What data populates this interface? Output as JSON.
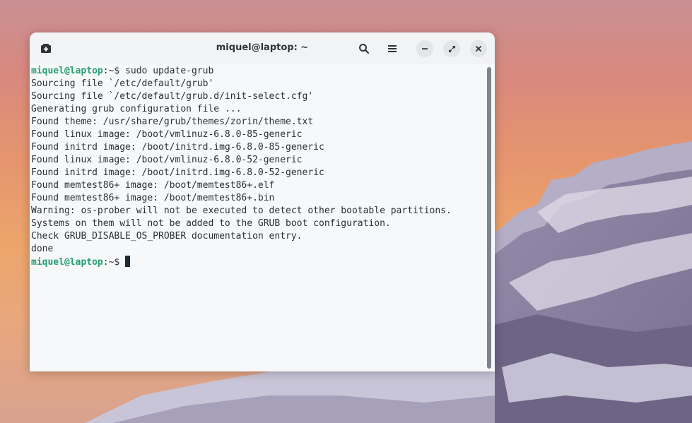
{
  "window": {
    "title": "miquel@laptop: ~"
  },
  "titlebar": {
    "new_tab_icon": "new-tab-icon",
    "search_icon": "search-icon",
    "menu_icon": "hamburger-menu-icon",
    "minimize_icon": "minimize-icon",
    "maximize_icon": "maximize-icon",
    "close_icon": "close-icon"
  },
  "terminal": {
    "prompt_user": "miquel@laptop",
    "prompt_path": ":~$ ",
    "command": "sudo update-grub",
    "output": [
      "Sourcing file `/etc/default/grub'",
      "Sourcing file `/etc/default/grub.d/init-select.cfg'",
      "Generating grub configuration file ...",
      "Found theme: /usr/share/grub/themes/zorin/theme.txt",
      "Found linux image: /boot/vmlinuz-6.8.0-85-generic",
      "Found initrd image: /boot/initrd.img-6.8.0-85-generic",
      "Found linux image: /boot/vmlinuz-6.8.0-52-generic",
      "Found initrd image: /boot/initrd.img-6.8.0-52-generic",
      "Found memtest86+ image: /boot/memtest86+.elf",
      "Found memtest86+ image: /boot/memtest86+.bin",
      "Warning: os-prober will not be executed to detect other bootable partitions.",
      "Systems on them will not be added to the GRUB boot configuration.",
      "Check GRUB_DISABLE_OS_PROBER documentation entry.",
      "done"
    ],
    "final_prompt_user": "miquel@laptop",
    "final_prompt_path": ":~$ "
  },
  "colors": {
    "prompt_green": "#24a06f",
    "terminal_bg": "#f7f8fa",
    "text": "#2b2f33"
  }
}
